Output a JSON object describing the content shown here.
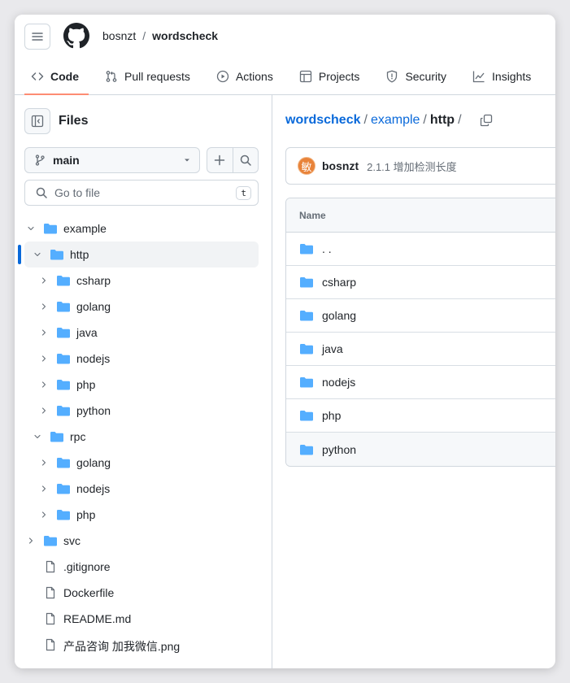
{
  "header": {
    "owner": "bosnzt",
    "separator": "/",
    "repo": "wordscheck",
    "tabs": [
      {
        "label": "Code",
        "icon": "code-icon",
        "active": true
      },
      {
        "label": "Pull requests",
        "icon": "pull-request-icon",
        "active": false
      },
      {
        "label": "Actions",
        "icon": "play-icon",
        "active": false
      },
      {
        "label": "Projects",
        "icon": "table-icon",
        "active": false
      },
      {
        "label": "Security",
        "icon": "shield-icon",
        "active": false
      },
      {
        "label": "Insights",
        "icon": "graph-icon",
        "active": false
      }
    ]
  },
  "sidebar": {
    "title": "Files",
    "branch": "main",
    "search_placeholder": "Go to file",
    "search_shortcut": "t",
    "tree": [
      {
        "label": "example",
        "type": "folder",
        "expanded": true,
        "depth": 0
      },
      {
        "label": "http",
        "type": "folder",
        "expanded": true,
        "depth": 1,
        "selected": true
      },
      {
        "label": "csharp",
        "type": "folder",
        "expanded": false,
        "depth": 2
      },
      {
        "label": "golang",
        "type": "folder",
        "expanded": false,
        "depth": 2
      },
      {
        "label": "java",
        "type": "folder",
        "expanded": false,
        "depth": 2
      },
      {
        "label": "nodejs",
        "type": "folder",
        "expanded": false,
        "depth": 2
      },
      {
        "label": "php",
        "type": "folder",
        "expanded": false,
        "depth": 2
      },
      {
        "label": "python",
        "type": "folder",
        "expanded": false,
        "depth": 2
      },
      {
        "label": "rpc",
        "type": "folder",
        "expanded": true,
        "depth": 1
      },
      {
        "label": "golang",
        "type": "folder",
        "expanded": false,
        "depth": 2
      },
      {
        "label": "nodejs",
        "type": "folder",
        "expanded": false,
        "depth": 2
      },
      {
        "label": "php",
        "type": "folder",
        "expanded": false,
        "depth": 2
      },
      {
        "label": "svc",
        "type": "folder",
        "expanded": false,
        "depth": 0
      },
      {
        "label": ".gitignore",
        "type": "file",
        "depth": 0
      },
      {
        "label": "Dockerfile",
        "type": "file",
        "depth": 0
      },
      {
        "label": "README.md",
        "type": "file",
        "depth": 0
      },
      {
        "label": "产品咨询 加我微信.png",
        "type": "file",
        "depth": 0
      }
    ]
  },
  "main": {
    "path": {
      "repo": "wordscheck",
      "seg1": "example",
      "seg2": "http",
      "sep": "/"
    },
    "commit": {
      "avatar_char": "敏",
      "author": "bosnzt",
      "message": "2.1.1 增加检测长度"
    },
    "table": {
      "header": "Name",
      "rows": [
        {
          "name": ". .",
          "icon": "folder-icon"
        },
        {
          "name": "csharp",
          "icon": "folder-icon"
        },
        {
          "name": "golang",
          "icon": "folder-icon"
        },
        {
          "name": "java",
          "icon": "folder-icon"
        },
        {
          "name": "nodejs",
          "icon": "folder-icon"
        },
        {
          "name": "php",
          "icon": "folder-icon"
        },
        {
          "name": "python",
          "icon": "folder-icon",
          "hover": true
        }
      ]
    }
  },
  "colors": {
    "accent": "#0969da",
    "folder": "#54aeff",
    "tab_underline": "#fd8c73",
    "avatar": "#e8833a"
  }
}
